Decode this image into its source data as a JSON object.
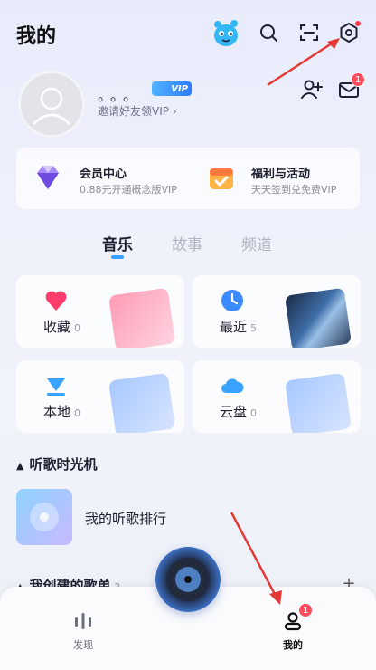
{
  "header": {
    "title": "我的"
  },
  "profile": {
    "username": "。。。",
    "vip_badge": "VIP",
    "invite_text": "邀请好友领VIP ›"
  },
  "cards": {
    "member_title": "会员中心",
    "member_sub": "0.88元开通概念版VIP",
    "welfare_title": "福利与活动",
    "welfare_sub": "天天签到兑免费VIP"
  },
  "inbox_badge": "1",
  "tabs": {
    "music": "音乐",
    "story": "故事",
    "channel": "频道",
    "active": "音乐"
  },
  "tiles": {
    "favorites": {
      "label": "收藏",
      "count": "0"
    },
    "recent": {
      "label": "最近",
      "count": "5"
    },
    "local": {
      "label": "本地",
      "count": "0"
    },
    "cloud": {
      "label": "云盘",
      "count": "0"
    }
  },
  "time_machine": {
    "title": "听歌时光机",
    "rank_label": "我的听歌排行"
  },
  "my_playlists": {
    "title": "我创建的歌单",
    "count": "2"
  },
  "bottom_nav": {
    "discover": "发现",
    "mine": "我的",
    "mine_badge": "1"
  },
  "colors": {
    "accent": "#3aa2ff",
    "badge_red": "#ff4d5e",
    "annotation_red": "#e53935"
  }
}
